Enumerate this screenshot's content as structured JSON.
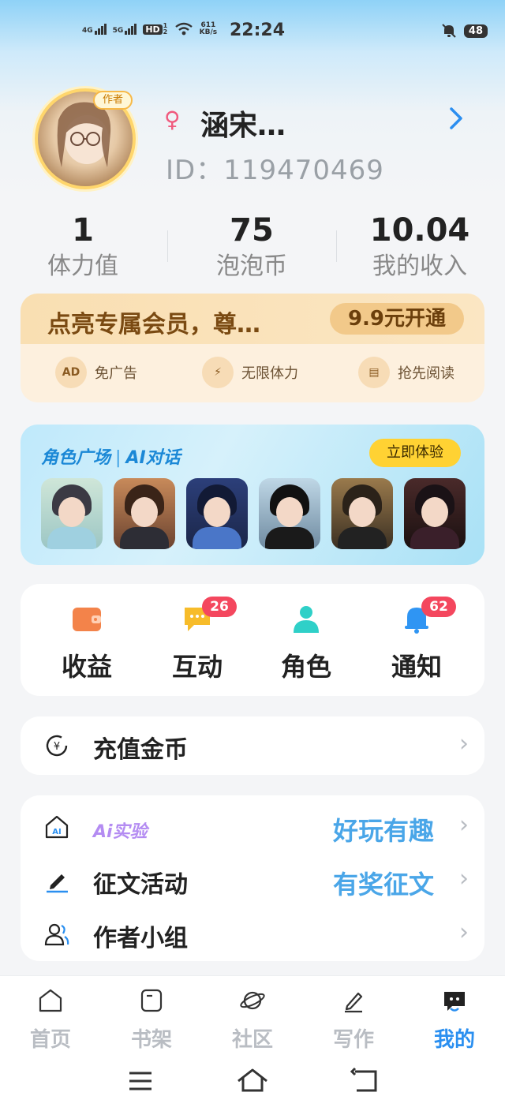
{
  "status_bar": {
    "sig1_label": "4G",
    "sig2_label": "5G",
    "hd_label": "HD",
    "hd_sub": "1 2",
    "speed_value": "611",
    "speed_unit": "KB/s",
    "time": "22:24",
    "battery": "48"
  },
  "profile": {
    "author_badge": "作者",
    "gender_symbol": "♀",
    "username": "涵宋…",
    "user_id": "ID：119470469"
  },
  "stats": [
    {
      "value": "1",
      "label": "体力值"
    },
    {
      "value": "75",
      "label": "泡泡币"
    },
    {
      "value": "10.04",
      "label": "我的收入"
    }
  ],
  "vip": {
    "title": "点亮专属会员，尊…",
    "button": "9.9元开通",
    "benefits": [
      {
        "icon_text": "AD",
        "label": "免广告"
      },
      {
        "icon_text": "⚡",
        "label": "无限体力"
      },
      {
        "icon_text": "▤",
        "label": "抢先阅读"
      }
    ]
  },
  "plaza": {
    "title_left": "角色广场",
    "title_sep": "|",
    "title_right": "AI对话",
    "button": "立即体验"
  },
  "actions": [
    {
      "label": "收益",
      "badge": ""
    },
    {
      "label": "互动",
      "badge": "26"
    },
    {
      "label": "角色",
      "badge": ""
    },
    {
      "label": "通知",
      "badge": "62"
    }
  ],
  "recharge": {
    "label": "充值金币",
    "arrow": "›"
  },
  "menu": {
    "ai_lab": {
      "label": "Ai实验",
      "value": "好玩有趣"
    },
    "contest": {
      "label": "征文活动",
      "value": "有奖征文"
    },
    "group": {
      "label": "作者小组"
    },
    "arrow": "›"
  },
  "bottom_nav": [
    {
      "label": "首页",
      "active": false
    },
    {
      "label": "书架",
      "active": false
    },
    {
      "label": "社区",
      "active": false
    },
    {
      "label": "写作",
      "active": false
    },
    {
      "label": "我的",
      "active": true
    }
  ],
  "colors": {
    "accent": "#2a8ff0",
    "badge": "#f4475e",
    "vip_bg": "#fdf0de",
    "link_value": "#4aa6e8"
  }
}
